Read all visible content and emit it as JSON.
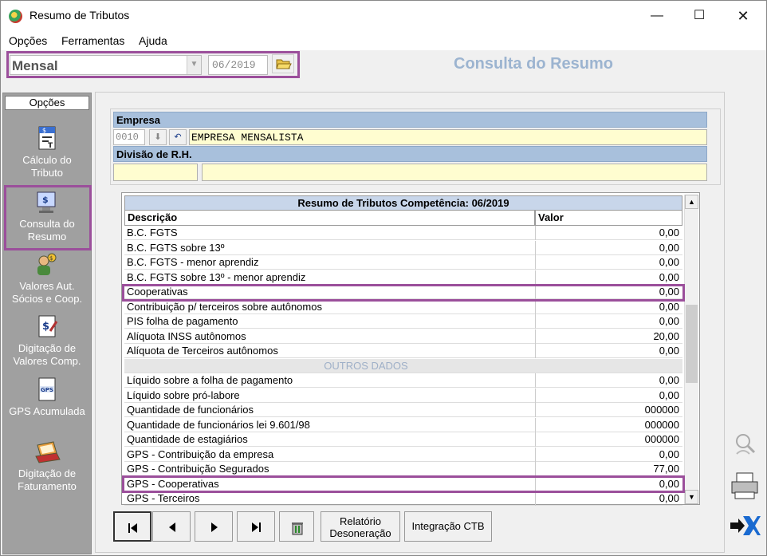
{
  "window": {
    "title": "Resumo de Tributos",
    "controls": {
      "minimize": "—",
      "maximize": "☐",
      "close": "✕"
    }
  },
  "menu": [
    "Opções",
    "Ferramentas",
    "Ajuda"
  ],
  "toolbar": {
    "period_selected": "Mensal",
    "competence": "06/2019",
    "heading": "Consulta do Resumo"
  },
  "sidebar": {
    "header": "Opções",
    "items": [
      {
        "label": "Cálculo do Tributo",
        "icon": "calc-document-icon"
      },
      {
        "label": "Consulta do Resumo",
        "icon": "monitor-dollar-icon"
      },
      {
        "label": "Valores Aut. Sócios e Coop.",
        "icon": "people-dollar-icon"
      },
      {
        "label": "Digitação de Valores Comp.",
        "icon": "dollar-edit-icon"
      },
      {
        "label": "GPS Acumulada",
        "icon": "gps-document-icon"
      },
      {
        "label": "Digitação de Faturamento",
        "icon": "laptop-icon"
      }
    ]
  },
  "company": {
    "section_label": "Empresa",
    "code": "0010",
    "name": "EMPRESA MENSALISTA",
    "division_label": "Divisão de R.H.",
    "division_code": "",
    "division_name": ""
  },
  "grid": {
    "title": "Resumo de Tributos Competência: 06/2019",
    "columns": [
      "Descrição",
      "Valor"
    ],
    "rows": [
      {
        "desc": "B.C. FGTS",
        "value": "0,00"
      },
      {
        "desc": "B.C. FGTS sobre 13º",
        "value": "0,00"
      },
      {
        "desc": "B.C. FGTS - menor aprendiz",
        "value": "0,00"
      },
      {
        "desc": "B.C. FGTS sobre 13º - menor aprendiz",
        "value": "0,00"
      },
      {
        "desc": "Cooperativas",
        "value": "0,00"
      },
      {
        "desc": "Contribuição p/ terceiros sobre autônomos",
        "value": "0,00"
      },
      {
        "desc": "PIS folha de pagamento",
        "value": "0,00"
      },
      {
        "desc": "Alíquota INSS autônomos",
        "value": "20,00"
      },
      {
        "desc": "Alíquota de Terceiros autônomos",
        "value": "0,00"
      },
      {
        "desc": "OUTROS DADOS",
        "value": ""
      },
      {
        "desc": "Líquido sobre a folha de pagamento",
        "value": "0,00"
      },
      {
        "desc": "Líquido sobre pró-labore",
        "value": "0,00"
      },
      {
        "desc": "Quantidade de funcionários",
        "value": "000000"
      },
      {
        "desc": "Quantidade de funcionários lei 9.601/98",
        "value": "000000"
      },
      {
        "desc": "Quantidade de estagiários",
        "value": "000000"
      },
      {
        "desc": "GPS - Contribuição da empresa",
        "value": "0,00"
      },
      {
        "desc": "GPS - Contribuição Segurados",
        "value": "77,00"
      },
      {
        "desc": "GPS - Cooperativas",
        "value": "0,00"
      },
      {
        "desc": "GPS - Terceiros",
        "value": "0,00"
      }
    ]
  },
  "nav": {
    "relatorio_line1": "Relatório",
    "relatorio_line2": "Desoneração",
    "integracao": "Integração CTB"
  },
  "colors": {
    "highlight": "#9b4f9b",
    "section_header": "#a8c0dc",
    "heading": "#9cb4d0"
  }
}
